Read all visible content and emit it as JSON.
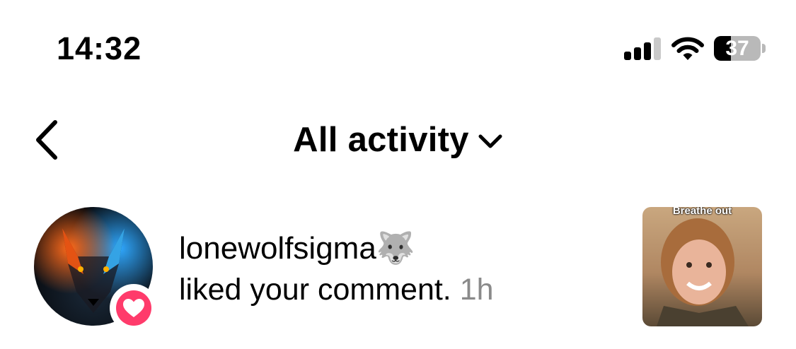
{
  "status_bar": {
    "time": "14:32",
    "battery_percent": "37",
    "battery_level": 0.37,
    "signal_bars_filled": 3,
    "signal_bars_total": 4
  },
  "header": {
    "title": "All activity",
    "back_icon": "chevron-left-icon",
    "dropdown_icon": "chevron-down-icon"
  },
  "activity": [
    {
      "username": "lonewolfsigma",
      "username_emoji": "🐺",
      "action": "liked your comment.",
      "time": "1h",
      "badge_icon": "heart-icon",
      "badge_color": "#ff3b6b",
      "thumbnail_caption": "Breathe out"
    }
  ],
  "colors": {
    "secondary_text": "#8a8a8a",
    "like_accent": "#ff3b6b"
  }
}
